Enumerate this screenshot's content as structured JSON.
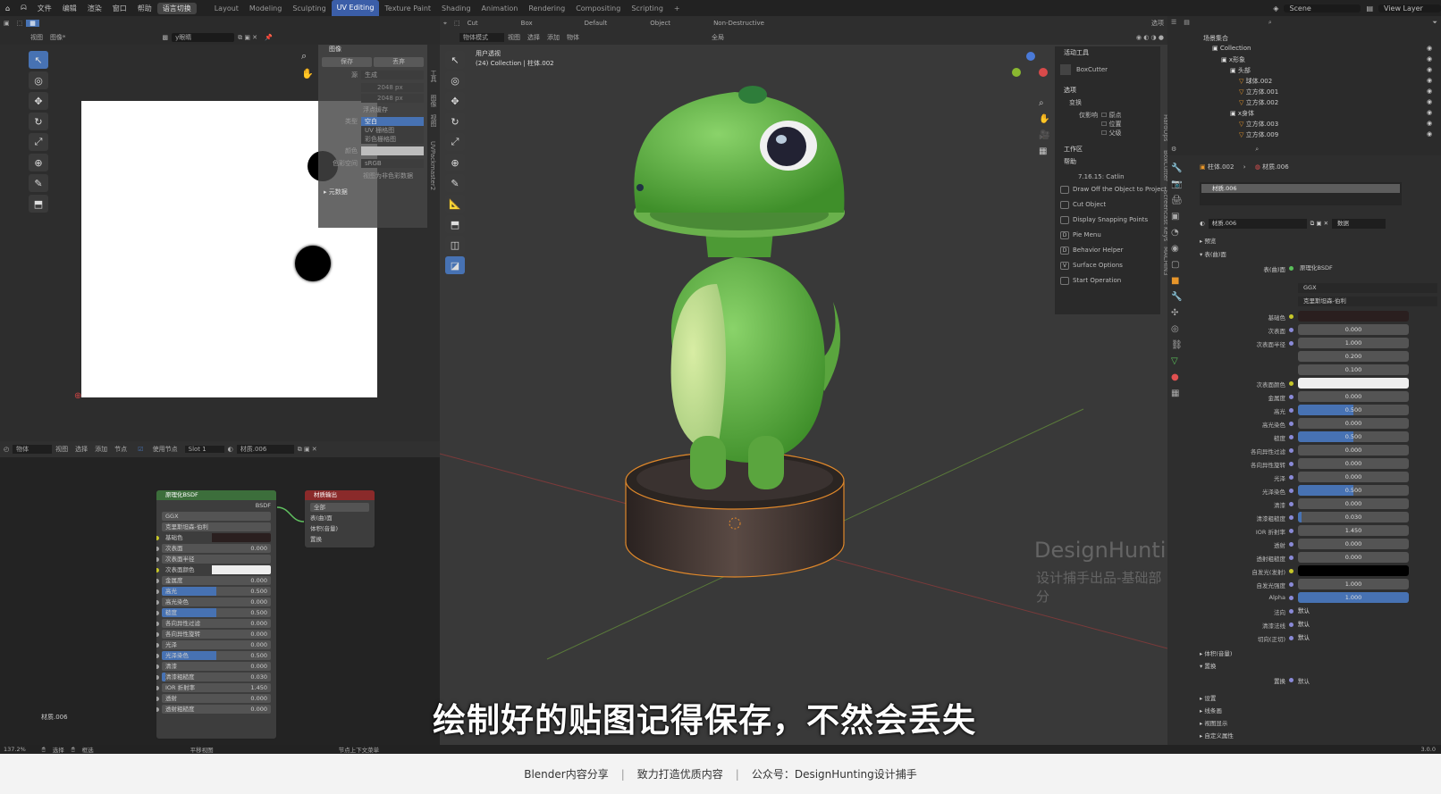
{
  "topbar": {
    "menus": [
      "文件",
      "编辑",
      "渲染",
      "窗口",
      "帮助"
    ],
    "lang_button": "语言切换",
    "workspaces": [
      "Layout",
      "Modeling",
      "Sculpting",
      "UV Editing",
      "Texture Paint",
      "Shading",
      "Animation",
      "Rendering",
      "Compositing",
      "Scripting"
    ],
    "active_workspace": "UV Editing",
    "scene": "Scene",
    "view_layer": "View Layer"
  },
  "image_editor": {
    "header_items": [
      "视图",
      "图像*"
    ],
    "image_name": "y眼睛",
    "npanel": {
      "section_image": "图像",
      "btn_save": "保存",
      "btn_replace": "丢弃",
      "source_label": "源",
      "source_value": "生成",
      "width": "2048 px",
      "height": "2048 px",
      "float_buffer": "浮点缓存",
      "type_label": "类型",
      "type_options": [
        "空白",
        "UV 栅格图",
        "彩色栅格图"
      ],
      "color_label": "颜色",
      "colorspace_label": "色彩空间",
      "colorspace_value": "sRGB",
      "view_transform": "视图为非色彩数据",
      "metadata": "元数据"
    },
    "sidetabs": [
      "工具",
      "图像",
      "视图",
      "UVPackmaster2"
    ]
  },
  "node_editor": {
    "header_items": [
      "物体",
      "视图",
      "选择",
      "添加",
      "节点"
    ],
    "use_nodes": "使用节点",
    "slot": "Slot 1",
    "material": "材质.006",
    "material_label": "材质.006",
    "bsdf_node": {
      "title": "原理化BSDF",
      "output": "BSDF",
      "distribution": "GGX",
      "subsurface_method": "克里斯坦森-伯利",
      "rows": [
        {
          "label": "基础色",
          "value": "",
          "fill": 0,
          "type": "color"
        },
        {
          "label": "次表面",
          "value": "0.000",
          "fill": 0
        },
        {
          "label": "次表面半径",
          "value": "",
          "fill": 0,
          "type": "dropdown"
        },
        {
          "label": "次表面颜色",
          "value": "",
          "fill": 0,
          "type": "white"
        },
        {
          "label": "金属度",
          "value": "0.000",
          "fill": 0
        },
        {
          "label": "高光",
          "value": "0.500",
          "fill": 0.5
        },
        {
          "label": "高光染色",
          "value": "0.000",
          "fill": 0
        },
        {
          "label": "糙度",
          "value": "0.500",
          "fill": 0.5
        },
        {
          "label": "各向异性过滤",
          "value": "0.000",
          "fill": 0
        },
        {
          "label": "各向异性旋转",
          "value": "0.000",
          "fill": 0
        },
        {
          "label": "光泽",
          "value": "0.000",
          "fill": 0
        },
        {
          "label": "光泽染色",
          "value": "0.500",
          "fill": 0.5
        },
        {
          "label": "清漆",
          "value": "0.000",
          "fill": 0
        },
        {
          "label": "清漆粗糙度",
          "value": "0.030",
          "fill": 0.03
        },
        {
          "label": "IOR 折射率",
          "value": "1.450",
          "fill": 0
        },
        {
          "label": "透射",
          "value": "0.000",
          "fill": 0
        },
        {
          "label": "透射粗糙度",
          "value": "0.000",
          "fill": 0
        }
      ]
    },
    "output_node": {
      "title": "材质输出",
      "target": "全部",
      "sockets": [
        "表(曲)面",
        "体积(音量)",
        "置换"
      ]
    }
  },
  "viewport": {
    "header_items": [
      "物体模式",
      "视图",
      "选择",
      "添加",
      "物体"
    ],
    "global": "全局",
    "tool_cut": "Cut",
    "tool_box": "Box",
    "default": "Default",
    "object": "Object",
    "nondestructive": "Non-Destructive",
    "options": "选项",
    "view_name": "用户透视",
    "collection_info": "(24) Collection | 柱体.002",
    "watermark_title": "DesignHunting",
    "watermark_sub": "设计捕手出品-基础部分",
    "npanel": {
      "active_tool": "活动工具",
      "boxcutter": "BoxCutter",
      "options": "选项",
      "transform": "变换",
      "affect_only": "仅影响",
      "origins": "原点",
      "locations": "位置",
      "parents": "父级",
      "workspace": "工作区",
      "help": "帮助",
      "version": "7.16.15: Catlin",
      "help_lines": [
        "Draw Off the Object to Project",
        "Cut Object",
        "Display Snapping Points",
        "Pie Menu",
        "Behavior Helper",
        "Surface Options",
        "Start Operation"
      ],
      "keys": [
        "",
        "",
        "",
        "D",
        "D",
        "V",
        ""
      ]
    },
    "sidetabs": [
      "HardOps",
      "BoxCutter",
      "Screencast Keys",
      "MACHIN3"
    ]
  },
  "outliner": {
    "root": "场景集合",
    "items": [
      {
        "name": "Collection",
        "indent": 1
      },
      {
        "name": "x形象",
        "indent": 2
      },
      {
        "name": "头部",
        "indent": 3
      },
      {
        "name": "球体.002",
        "indent": 4
      },
      {
        "name": "立方体.001",
        "indent": 4
      },
      {
        "name": "立方体.002",
        "indent": 4
      },
      {
        "name": "x身体",
        "indent": 3
      },
      {
        "name": "立方体.003",
        "indent": 4
      },
      {
        "name": "立方体.009",
        "indent": 4
      }
    ]
  },
  "properties": {
    "object": "柱体.002",
    "material_tab": "材质.006",
    "slot_name": "材质.006",
    "material_name": "材质.006",
    "data_label": "数据",
    "preview": "预览",
    "surface": "表(曲)面",
    "surface_label": "表(曲)面",
    "surface_value": "原理化BSDF",
    "distribution": "GGX",
    "subsurface_method": "克里斯坦森-伯利",
    "rows": [
      {
        "label": "基础色",
        "value": "",
        "fill": 0,
        "type": "dark"
      },
      {
        "label": "次表面",
        "value": "0.000",
        "fill": 0
      },
      {
        "label": "次表面半径",
        "value": "1.000",
        "fill": 0
      },
      {
        "label": "",
        "value": "0.200",
        "fill": 0
      },
      {
        "label": "",
        "value": "0.100",
        "fill": 0
      },
      {
        "label": "次表面颜色",
        "value": "",
        "fill": 0,
        "type": "white"
      },
      {
        "label": "金属度",
        "value": "0.000",
        "fill": 0
      },
      {
        "label": "高光",
        "value": "0.500",
        "fill": 0.5
      },
      {
        "label": "高光染色",
        "value": "0.000",
        "fill": 0
      },
      {
        "label": "糙度",
        "value": "0.500",
        "fill": 0.5
      },
      {
        "label": "各向异性过滤",
        "value": "0.000",
        "fill": 0
      },
      {
        "label": "各向异性旋转",
        "value": "0.000",
        "fill": 0
      },
      {
        "label": "光泽",
        "value": "0.000",
        "fill": 0
      },
      {
        "label": "光泽染色",
        "value": "0.500",
        "fill": 0.5
      },
      {
        "label": "清漆",
        "value": "0.000",
        "fill": 0
      },
      {
        "label": "清漆粗糙度",
        "value": "0.030",
        "fill": 0.03
      },
      {
        "label": "IOR 折射率",
        "value": "1.450",
        "fill": 0
      },
      {
        "label": "透射",
        "value": "0.000",
        "fill": 0
      },
      {
        "label": "透射粗糙度",
        "value": "0.000",
        "fill": 0
      },
      {
        "label": "自发光(发射)",
        "value": "",
        "fill": 0,
        "type": "black"
      },
      {
        "label": "自发光强度",
        "value": "1.000",
        "fill": 0
      },
      {
        "label": "Alpha",
        "value": "1.000",
        "fill": 1
      },
      {
        "label": "法向",
        "value": "默认",
        "fill": 0,
        "type": "text"
      },
      {
        "label": "清漆法线",
        "value": "默认",
        "fill": 0,
        "type": "text"
      },
      {
        "label": "切向(正切)",
        "value": "默认",
        "fill": 0,
        "type": "text"
      }
    ],
    "volume": "体积(音量)",
    "displacement": "置换",
    "displacement_label": "置换",
    "displacement_value": "默认",
    "settings": "设置",
    "lineart": "线条画",
    "viewport_display": "视图显示",
    "custom_props": "自定义属性",
    "version": "3.0.0"
  },
  "statusbar": {
    "zoom": "137.2%",
    "select": "选择",
    "pan": "框选",
    "pan_view": "平移视图",
    "context_menu": "节点上下文菜单"
  },
  "subtitle": "绘制好的贴图记得保存，不然会丢失",
  "footer": {
    "parts": [
      "Blender内容分享",
      "致力打造优质内容",
      "公众号：DesignHunting设计捕手"
    ],
    "sep": "|"
  }
}
